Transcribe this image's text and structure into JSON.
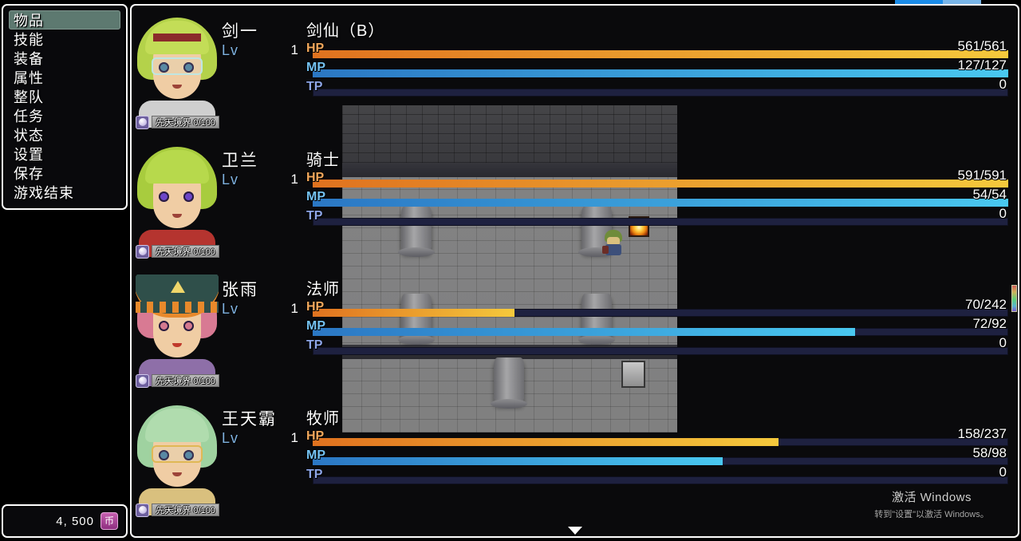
{
  "window": {
    "scroll_down_icon": "chevron-down-icon",
    "scroll_thumb": "scrollbar-thumb"
  },
  "command_menu": {
    "items": [
      {
        "label": "物品",
        "selected": true
      },
      {
        "label": "技能",
        "selected": false
      },
      {
        "label": "装备",
        "selected": false
      },
      {
        "label": "属性",
        "selected": false
      },
      {
        "label": "整队",
        "selected": false
      },
      {
        "label": "任务",
        "selected": false
      },
      {
        "label": "状态",
        "selected": false
      },
      {
        "label": "设置",
        "selected": false
      },
      {
        "label": "保存",
        "selected": false
      },
      {
        "label": "游戏结束",
        "selected": false
      }
    ]
  },
  "gold": {
    "amount": "4, 500",
    "currency_icon": "currency-icon",
    "currency_glyph": "币"
  },
  "gauge_labels": {
    "hp": "HP",
    "mp": "MP",
    "tp": "TP"
  },
  "level_label": "Lv",
  "party": [
    {
      "name": "剑一",
      "class": "剑仙（B）",
      "level": "1",
      "hp": {
        "value": "561/561",
        "percent": 100
      },
      "mp": {
        "value": "127/127",
        "percent": 100
      },
      "tp": {
        "value": "0",
        "percent": 0
      },
      "badge": {
        "text": "先天境界 0/100",
        "percent": 0
      }
    },
    {
      "name": "卫兰",
      "class": "骑士",
      "level": "1",
      "hp": {
        "value": "591/591",
        "percent": 100
      },
      "mp": {
        "value": "54/54",
        "percent": 100
      },
      "tp": {
        "value": "0",
        "percent": 0
      },
      "badge": {
        "text": "先天境界 0/100",
        "percent": 0
      }
    },
    {
      "name": "张雨",
      "class": "法师",
      "level": "1",
      "hp": {
        "value": "70/242",
        "percent": 29
      },
      "mp": {
        "value": "72/92",
        "percent": 78
      },
      "tp": {
        "value": "0",
        "percent": 0
      },
      "badge": {
        "text": "先天境界 0/100",
        "percent": 0
      }
    },
    {
      "name": "王天霸",
      "class": "牧师",
      "level": "1",
      "hp": {
        "value": "158/237",
        "percent": 67
      },
      "mp": {
        "value": "58/98",
        "percent": 59
      },
      "tp": {
        "value": "0",
        "percent": 0
      },
      "badge": {
        "text": "先天境界 0/100",
        "percent": 0
      }
    }
  ],
  "watermark": {
    "title": "激活 Windows",
    "subtitle": "转到\"设置\"以激活 Windows。"
  },
  "colors": {
    "hp_start": "#e0721f",
    "hp_end": "#f5c93c",
    "mp_start": "#2b77c4",
    "mp_end": "#49c8f0",
    "gauge_back": "#1e2140",
    "selection": "#5d7970",
    "window_border": "#ffffff",
    "gold_icon": "#8e2f80"
  }
}
